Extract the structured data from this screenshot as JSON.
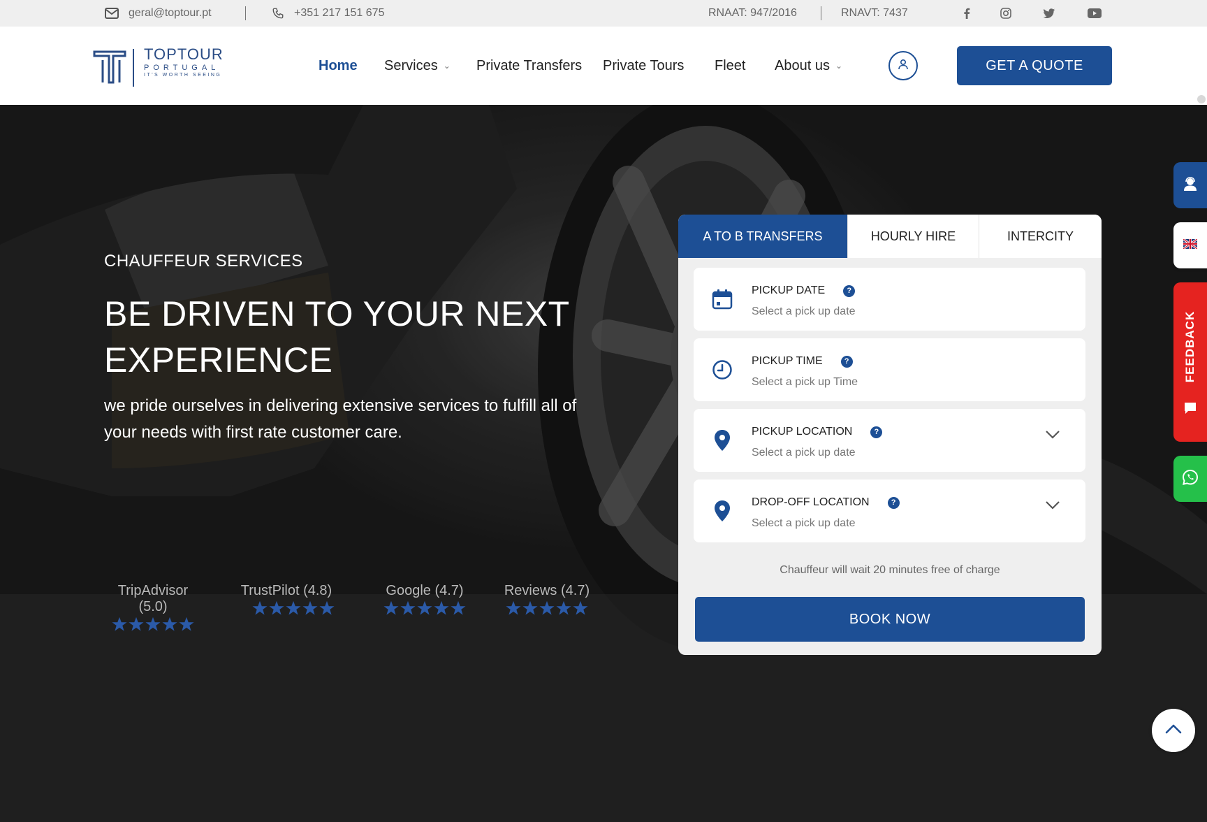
{
  "topbar": {
    "email": "geral@toptour.pt",
    "phone": "+351 217 151 675",
    "rnaat": "RNAAT: 947/2016",
    "rnavt": "RNAVT: 7437",
    "social_icons": [
      "facebook-icon",
      "instagram-icon",
      "twitter-icon",
      "youtube-icon"
    ]
  },
  "logo": {
    "title": "TOPTOUR",
    "subtitle": "PORTUGAL",
    "tagline": "IT'S WORTH SEEING"
  },
  "nav": {
    "items": [
      {
        "label": "Home",
        "active": true
      },
      {
        "label": "Services",
        "dropdown": true
      },
      {
        "label": "Private Transfers"
      },
      {
        "label": "Private Tours"
      },
      {
        "label": "Fleet"
      },
      {
        "label": "About us",
        "dropdown": true
      }
    ],
    "quote_label": "GET A QUOTE"
  },
  "hero": {
    "kicker": "CHAUFFEUR SERVICES",
    "title": "BE DRIVEN TO YOUR NEXT EXPERIENCE",
    "description": "we pride ourselves in delivering extensive services to fulfill all of your needs with first rate customer care.",
    "ratings": [
      {
        "label": "TripAdvisor (5.0)",
        "stars": 5
      },
      {
        "label": "TrustPilot (4.8)",
        "stars": 5
      },
      {
        "label": "Google (4.7)",
        "stars": 5
      },
      {
        "label": "Reviews (4.7)",
        "stars": 5
      }
    ]
  },
  "booking": {
    "tabs": [
      {
        "label": "A TO B TRANSFERS",
        "active": true
      },
      {
        "label": "HOURLY HIRE"
      },
      {
        "label": "INTERCITY"
      }
    ],
    "fields": [
      {
        "label": "PICKUP DATE",
        "value": "Select a pick up date",
        "icon": "calendar-icon"
      },
      {
        "label": "PICKUP TIME",
        "value": "Select a pick up Time",
        "icon": "clock-icon"
      },
      {
        "label": "PICKUP LOCATION",
        "value": "Select a pick up date",
        "icon": "location-pin-icon"
      },
      {
        "label": "DROP-OFF LOCATION",
        "value": "Select a pick up date",
        "icon": "location-pin-icon"
      }
    ],
    "help_symbol": "?",
    "note": "Chauffeur will wait 20 minutes free of charge",
    "book_label": "BOOK NOW"
  },
  "side": {
    "feedback_label": "FEEDBACK"
  },
  "colors": {
    "brand_blue": "#1d4f95",
    "feedback_red": "#e52320",
    "whatsapp_green": "#25c04a",
    "star_blue": "#2b5aa8"
  }
}
